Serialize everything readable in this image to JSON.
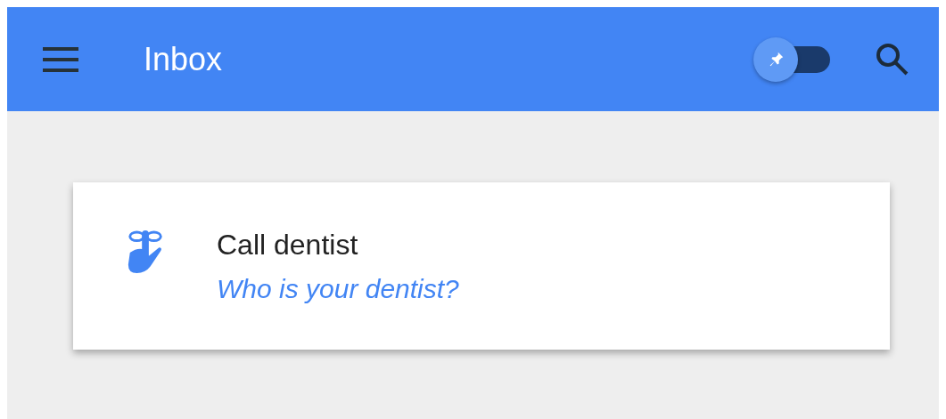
{
  "app_bar": {
    "title": "Inbox",
    "pinned_toggle": {
      "on": true
    }
  },
  "reminder_card": {
    "title": "Call dentist",
    "subtitle": "Who is your dentist?"
  }
}
